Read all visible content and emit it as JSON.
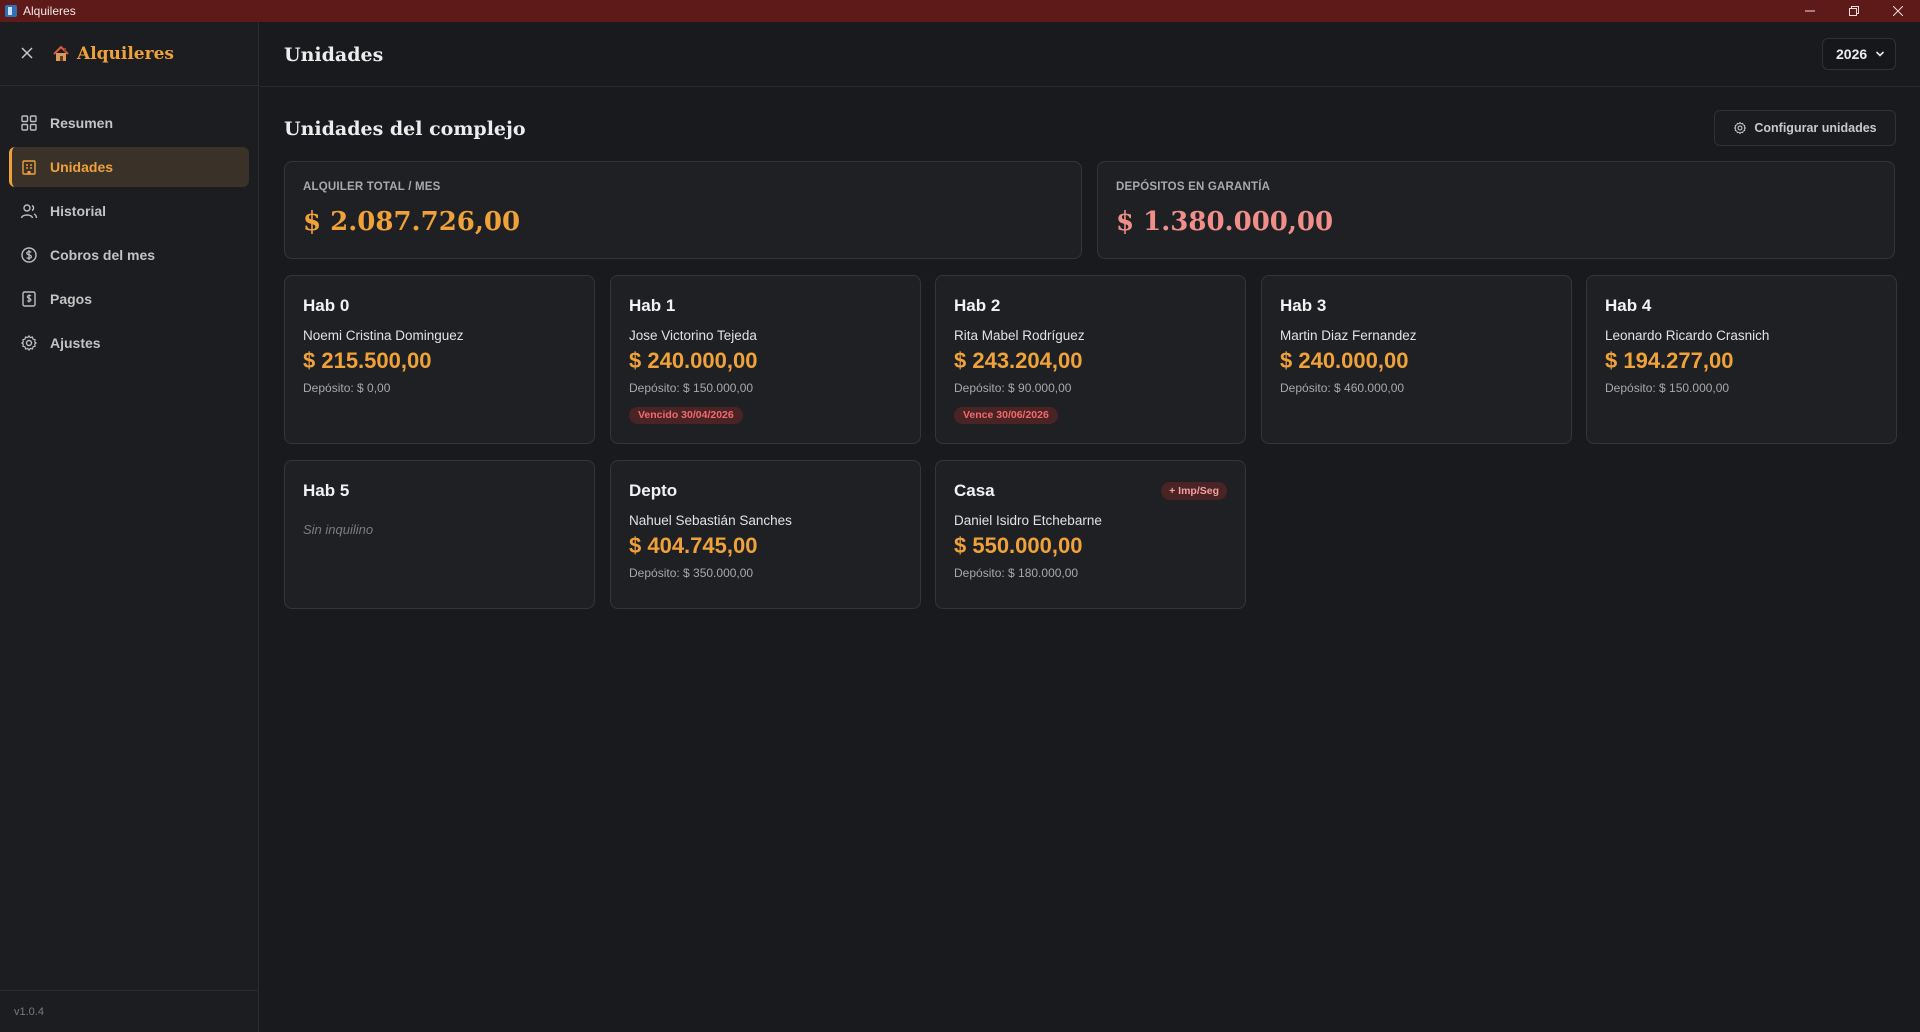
{
  "window": {
    "title": "Alquileres"
  },
  "sidebar": {
    "brand": "Alquileres",
    "items": [
      {
        "label": "Resumen",
        "icon": "grid-icon"
      },
      {
        "label": "Unidades",
        "icon": "building-icon",
        "active": true
      },
      {
        "label": "Historial",
        "icon": "users-icon"
      },
      {
        "label": "Cobros del mes",
        "icon": "dollar-circle-icon"
      },
      {
        "label": "Pagos",
        "icon": "receipt-icon"
      },
      {
        "label": "Ajustes",
        "icon": "gear-icon"
      }
    ],
    "version": "v1.0.4"
  },
  "header": {
    "title": "Unidades",
    "year": "2026"
  },
  "main": {
    "section_title": "Unidades del complejo",
    "config_button": "Configurar unidades",
    "summary": {
      "rent_label": "ALQUILER TOTAL / MES",
      "rent_value": "$ 2.087.726,00",
      "deposit_label": "DEPÓSITOS EN GARANTÍA",
      "deposit_value": "$ 1.380.000,00"
    },
    "units": [
      {
        "name": "Hab 0",
        "tenant": "Noemi Cristina Dominguez",
        "rent": "$ 215.500,00",
        "deposit": "Depósito: $ 0,00"
      },
      {
        "name": "Hab 1",
        "tenant": "Jose Victorino Tejeda",
        "rent": "$ 240.000,00",
        "deposit": "Depósito: $ 150.000,00",
        "badge": "Vencido 30/04/2026"
      },
      {
        "name": "Hab 2",
        "tenant": "Rita Mabel Rodríguez",
        "rent": "$ 243.204,00",
        "deposit": "Depósito: $ 90.000,00",
        "badge": "Vence 30/06/2026"
      },
      {
        "name": "Hab 3",
        "tenant": "Martin Diaz Fernandez",
        "rent": "$ 240.000,00",
        "deposit": "Depósito: $ 460.000,00"
      },
      {
        "name": "Hab 4",
        "tenant": "Leonardo Ricardo Crasnich",
        "rent": "$ 194.277,00",
        "deposit": "Depósito: $ 150.000,00"
      },
      {
        "name": "Hab 5",
        "empty": "Sin inquilino"
      },
      {
        "name": "Depto",
        "tenant": "Nahuel Sebastián Sanches",
        "rent": "$ 404.745,00",
        "deposit": "Depósito: $ 350.000,00"
      },
      {
        "name": "Casa",
        "tenant": "Daniel Isidro Etchebarne",
        "rent": "$ 550.000,00",
        "deposit": "Depósito: $ 180.000,00",
        "tag": "+ Imp/Seg"
      }
    ]
  },
  "colors": {
    "accent": "#f0a23a",
    "danger": "#f26a6a",
    "titlebar": "#5e1a19"
  }
}
